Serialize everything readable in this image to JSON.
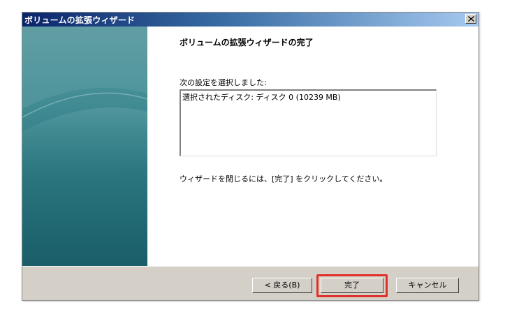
{
  "window": {
    "title": "ボリュームの拡張ウィザード",
    "close_icon": "close-icon"
  },
  "content": {
    "heading": "ボリュームの拡張ウィザードの完了",
    "selected_label": "次の設定を選択しました:",
    "settings_box_text": "選択されたディスク: ディスク 0 (10239 MB)",
    "close_instruction": "ウィザードを閉じるには、[完了] をクリックしてください。"
  },
  "buttons": {
    "back": "< 戻る(B)",
    "finish": "完了",
    "cancel": "キャンセル"
  },
  "colors": {
    "title_bar_start": "#0a246a",
    "title_bar_end": "#a6caf0",
    "side_panel": "#2c7780",
    "footer": "#d4d0c8",
    "highlight": "#e0302a"
  }
}
